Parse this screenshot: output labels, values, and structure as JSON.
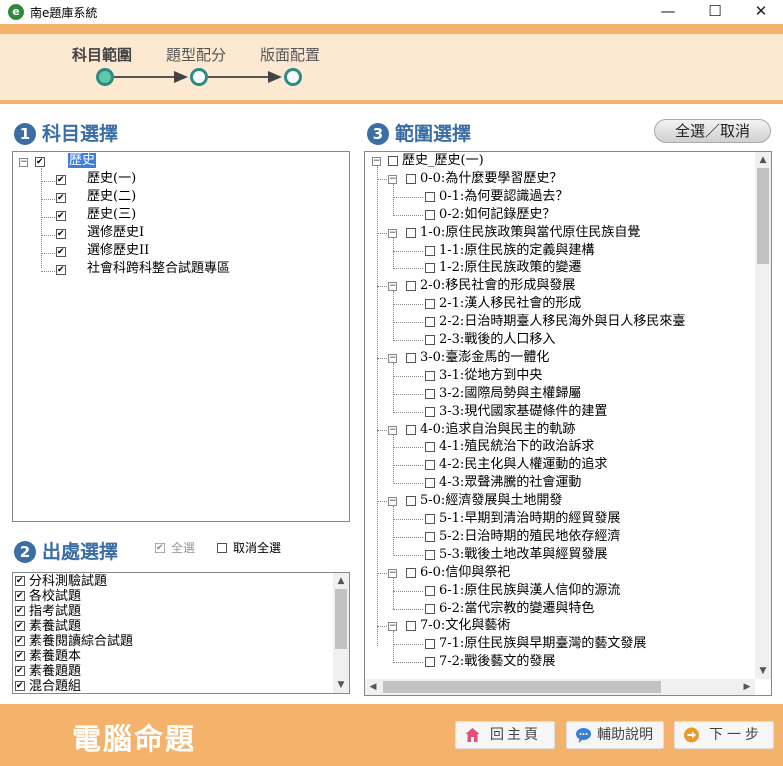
{
  "window": {
    "title": "南e題庫系統",
    "minimize": "—",
    "maximize": "☐",
    "close": "✕"
  },
  "steps": [
    {
      "label": "科目範圍",
      "active": true
    },
    {
      "label": "題型配分",
      "active": false
    },
    {
      "label": "版面配置",
      "active": false
    }
  ],
  "subject": {
    "num": "1",
    "title": "科目選擇",
    "root": "歷史",
    "items": [
      "歷史(一)",
      "歷史(二)",
      "歷史(三)",
      "選修歷史I",
      "選修歷史II",
      "社會科跨科整合試題專區"
    ]
  },
  "range": {
    "num": "3",
    "title": "範圍選擇",
    "toggle_all": "全選／取消",
    "root": "歷史_歷史(一)",
    "groups": [
      {
        "label": "0-0:為什麼要學習歷史？",
        "children": [
          "0-1:為何要認識過去？",
          "0-2:如何記錄歷史？"
        ]
      },
      {
        "label": "1-0:原住民族政策與當代原住民族自覺",
        "children": [
          "1-1:原住民族的定義與建構",
          "1-2:原住民族政策的變遷"
        ]
      },
      {
        "label": "2-0:移民社會的形成與發展",
        "children": [
          "2-1:漢人移民社會的形成",
          "2-2:日治時期臺人移民海外與日人移民來臺",
          "2-3:戰後的人口移入"
        ]
      },
      {
        "label": "3-0:臺澎金馬的一體化",
        "children": [
          "3-1:從地方到中央",
          "3-2:國際局勢與主權歸屬",
          "3-3:現代國家基礎條件的建置"
        ]
      },
      {
        "label": "4-0:追求自治與民主的軌跡",
        "children": [
          "4-1:殖民統治下的政治訴求",
          "4-2:民主化與人權運動的追求",
          "4-3:眾聲沸騰的社會運動"
        ]
      },
      {
        "label": "5-0:經濟發展與土地開發",
        "children": [
          "5-1:早期到清治時期的經貿發展",
          "5-2:日治時期的殖民地依存經濟",
          "5-3:戰後土地改革與經貿發展"
        ]
      },
      {
        "label": "6-0:信仰與祭祀",
        "children": [
          "6-1:原住民族與漢人信仰的源流",
          "6-2:當代宗教的變遷與特色"
        ]
      },
      {
        "label": "7-0:文化與藝術",
        "children": [
          "7-1:原住民族與早期臺灣的藝文發展",
          "7-2:戰後藝文的發展"
        ]
      }
    ]
  },
  "source": {
    "num": "2",
    "title": "出處選擇",
    "select_all": "全選",
    "cancel_all": "取消全選",
    "items": [
      "分科測驗試題",
      "各校試題",
      "指考試題",
      "素養試題",
      "素養閱讀綜合試題",
      "素養題本",
      "素養題題",
      "混合題組"
    ]
  },
  "footer": {
    "title": "電腦命題",
    "home": "回主頁",
    "help": "輔助說明",
    "next": "下一步"
  },
  "colors": {
    "orange": "#f5b26b",
    "header_bg": "#fde8d2",
    "accent_blue": "#3a6ea5",
    "step_teal": "#2e8b84"
  }
}
